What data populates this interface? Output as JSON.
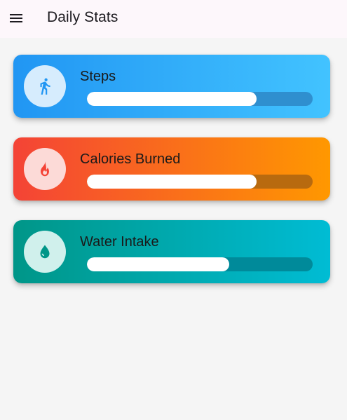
{
  "app_bar": {
    "title": "Daily Stats",
    "background": "#fdf7fb",
    "menu_icon": "menu-icon"
  },
  "cards": [
    {
      "label": "Steps",
      "icon": "walking-icon",
      "progress": 0.75,
      "gradient": [
        "#2196f3",
        "#42c3ff"
      ],
      "icon_bg": "#d6ecfd",
      "icon_color": "#2196f3",
      "track_color": "#2f8fcf"
    },
    {
      "label": "Calories Burned",
      "icon": "fire-icon",
      "progress": 0.75,
      "gradient": [
        "#f44336",
        "#ff9800"
      ],
      "icon_bg": "#fcdad7",
      "icon_color": "#f44336",
      "track_color": "#b86a0f"
    },
    {
      "label": "Water Intake",
      "icon": "water-drop-icon",
      "progress": 0.63,
      "gradient": [
        "#009688",
        "#00bcd4"
      ],
      "icon_bg": "#d0f0ec",
      "icon_color": "#009688",
      "track_color": "#008a9a"
    }
  ]
}
